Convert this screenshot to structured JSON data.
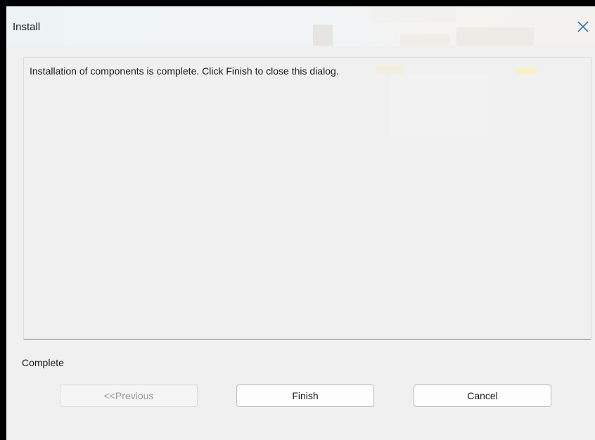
{
  "window": {
    "title": "Install"
  },
  "content": {
    "message": "Installation of components is complete.  Click Finish to close this dialog."
  },
  "status": {
    "text": "Complete"
  },
  "buttons": {
    "previous_label": "<<Previous",
    "previous_enabled": false,
    "finish_label": "Finish",
    "cancel_label": "Cancel"
  },
  "icons": {
    "close": "close-icon"
  },
  "colors": {
    "window_bg": "#f0f0f0",
    "close_icon": "#3a6ea5"
  }
}
